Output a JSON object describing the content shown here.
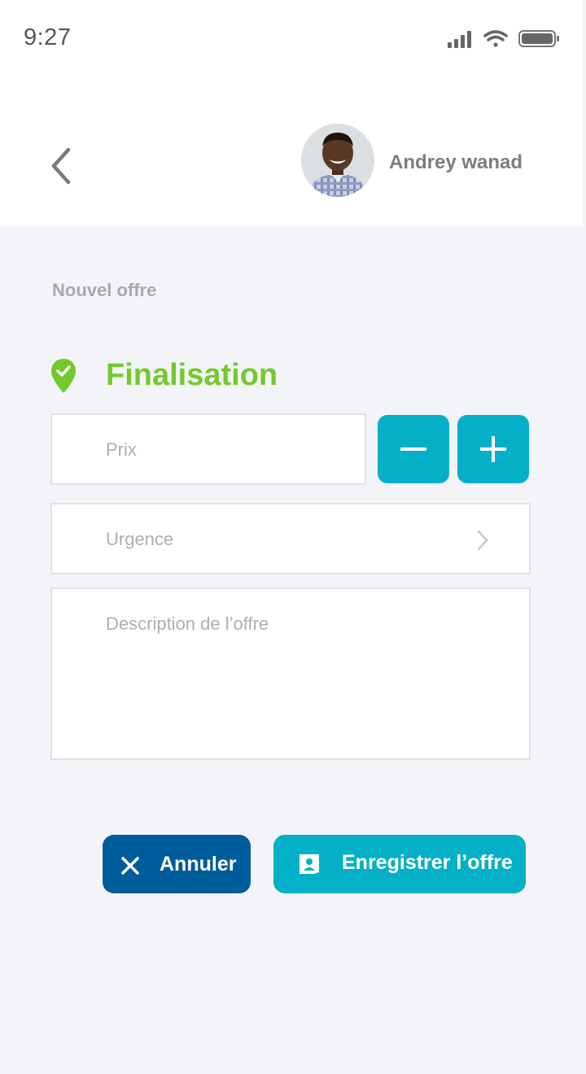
{
  "status_bar": {
    "time": "9:27"
  },
  "header": {
    "user_name": "Andrey wanad"
  },
  "page": {
    "section_title": "Nouvel offre",
    "step_title": "Finalisation"
  },
  "form": {
    "price_placeholder": "Prix",
    "urgency_placeholder": "Urgence",
    "description_placeholder": "Description de l’offre"
  },
  "actions": {
    "cancel_label": "Annuler",
    "save_label": "Enregistrer l’offre"
  },
  "icons": {
    "back": "chevron-left-icon",
    "step": "location-check-icon",
    "minus": "minus-icon",
    "plus": "plus-icon",
    "urgency": "chevron-right-icon",
    "cancel": "close-icon",
    "save": "save-icon"
  },
  "colors": {
    "accent": "#04b0c8",
    "primary_dark": "#005d9b",
    "success": "#75c82b",
    "background": "#f2f4f7"
  }
}
